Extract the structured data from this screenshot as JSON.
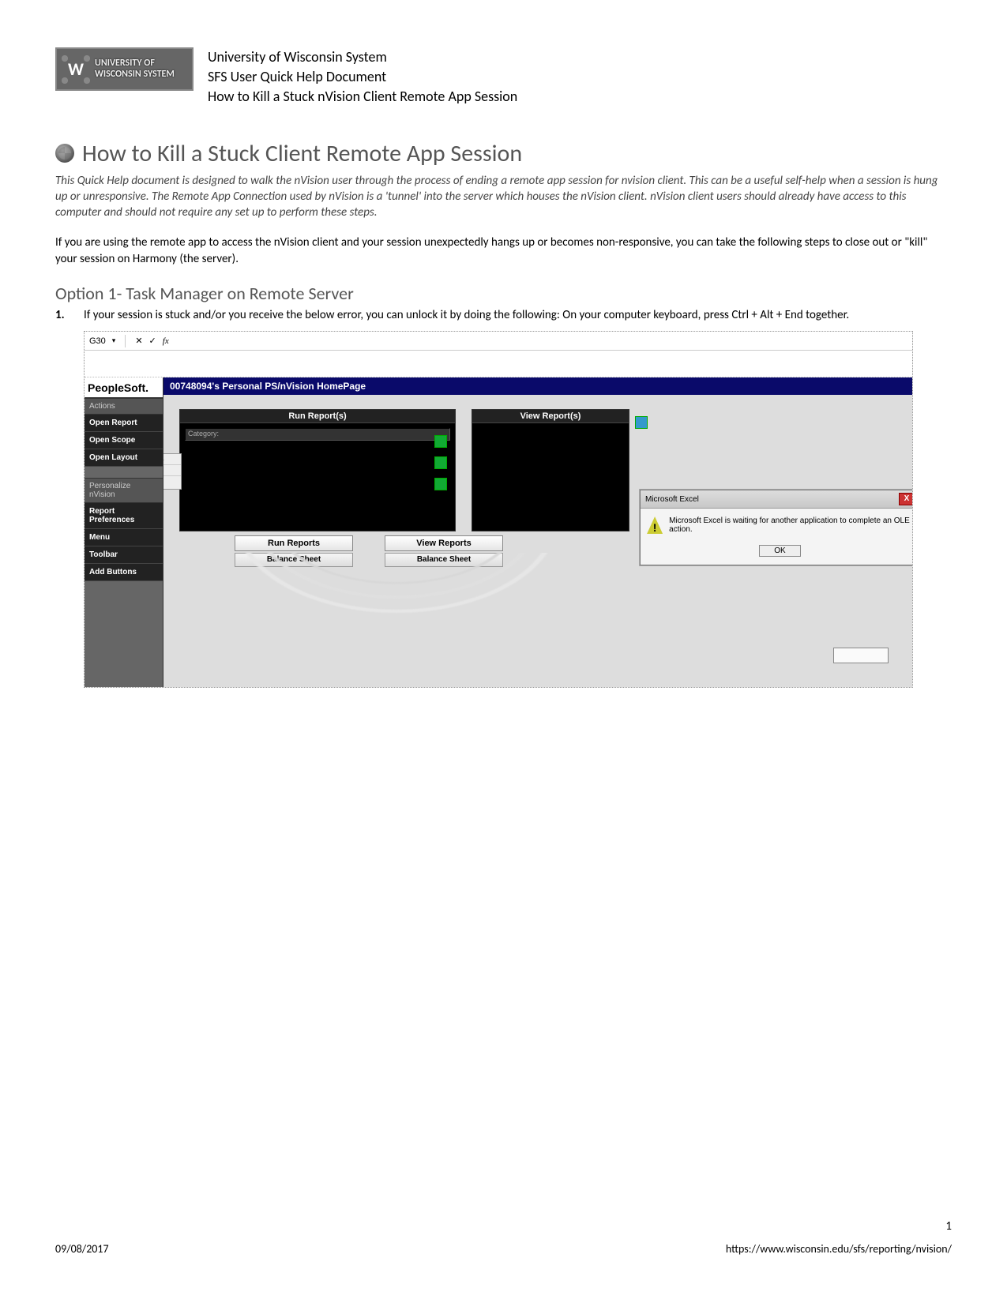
{
  "header": {
    "badge_line1": "UNIVERSITY OF",
    "badge_line2": "WISCONSIN SYSTEM",
    "line1": "University of Wisconsin System",
    "line2": "SFS User Quick Help Document",
    "line3": "How to Kill a Stuck nVision Client Remote App Session"
  },
  "title": "How to Kill a Stuck Client Remote App Session",
  "intro_italic": "This Quick Help document is designed to walk the nVision user through the process of ending a remote app session for nvision client. This can be a useful self-help when a session is hung up or unresponsive. The Remote App Connection used by nVision is a 'tunnel' into the server which houses the nVision client. nVision client users should already have access to this computer and should not require any set up to perform these steps.",
  "intro": "If you are using the remote app to access the nVision client and your session unexpectedly hangs up or becomes non-responsive, you can take the following steps to close out or \"kill\" your session on Harmony (the server).",
  "option1_heading": "Option 1- Task Manager on Remote Server",
  "step1_num": "1.",
  "step1_text": "If your session is stuck and/or you receive the below error, you can unlock it by doing the following: On your computer keyboard, press Ctrl + Alt + End together.",
  "shot": {
    "formula_cell": "G30",
    "fx": "fx",
    "brand": "PeopleSoft.",
    "sidebar": {
      "sec_actions": "Actions",
      "items_a": [
        "Open Report",
        "Open Scope",
        "Open Layout"
      ],
      "sec_personalize": "Personalize nVision",
      "items_b": [
        "Report Preferences",
        "Menu",
        "Toolbar",
        "Add Buttons"
      ]
    },
    "window_title": "00748094's Personal PS/nVision HomePage",
    "panels": {
      "run": "Run Report(s)",
      "view": "View Report(s)",
      "category": "Category:",
      "user_id": "00748094",
      "ok": "OK"
    },
    "tabs": {
      "run_reports": "Run Reports",
      "view_reports": "View Reports",
      "balance_sheet": "Balance Sheet"
    },
    "dialog": {
      "title": "Microsoft Excel",
      "close": "X",
      "msg": "Microsoft Excel is waiting for another application to complete an OLE action.",
      "ok": "OK"
    }
  },
  "footer": {
    "date": "09/08/2017",
    "url": "https://www.wisconsin.edu/sfs/reporting/nvision/",
    "page": "1"
  }
}
